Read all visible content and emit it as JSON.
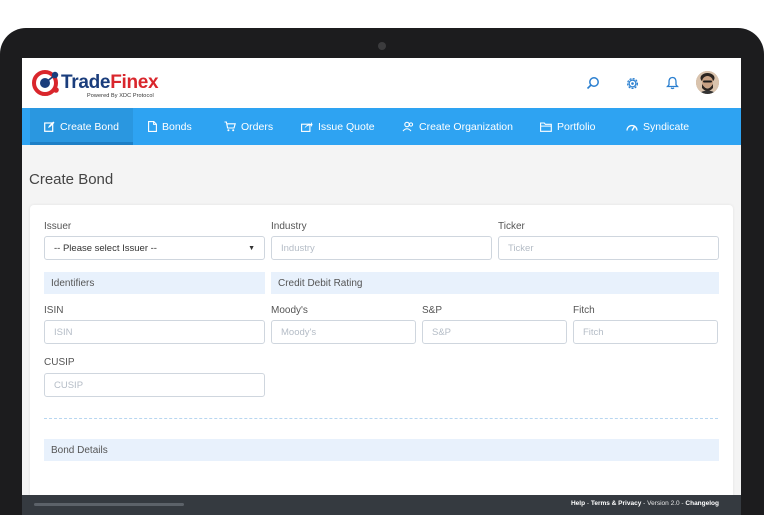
{
  "app": {
    "brand_part1": "Trade",
    "brand_part2": "Finex",
    "tagline": "Powered By XDC Protocol"
  },
  "header_icons": [
    "search-icon",
    "gear-icon",
    "bell-icon",
    "avatar"
  ],
  "nav": {
    "items": [
      {
        "label": "Create Bond",
        "icon": "edit-icon",
        "active": true
      },
      {
        "label": "Bonds",
        "icon": "document-icon"
      },
      {
        "label": "Orders",
        "icon": "cart-icon"
      },
      {
        "label": "Issue Quote",
        "icon": "share-icon"
      },
      {
        "label": "Create Organization",
        "icon": "users-icon"
      },
      {
        "label": "Portfolio",
        "icon": "folder-icon"
      },
      {
        "label": "Syndicate",
        "icon": "dashboard-icon"
      }
    ]
  },
  "page": {
    "title": "Create Bond"
  },
  "form": {
    "issuer": {
      "label": "Issuer",
      "value": "-- Please select Issuer --"
    },
    "industry": {
      "label": "Industry",
      "placeholder": "Industry"
    },
    "ticker": {
      "label": "Ticker",
      "placeholder": "Ticker"
    },
    "sections": {
      "identifiers": "Identifiers",
      "credit_debit_rating": "Credit Debit Rating",
      "bond_details": "Bond Details"
    },
    "isin": {
      "label": "ISIN",
      "placeholder": "ISIN"
    },
    "moodys": {
      "label": "Moody's",
      "placeholder": "Moody's"
    },
    "sp": {
      "label": "S&P",
      "placeholder": "S&P"
    },
    "fitch": {
      "label": "Fitch",
      "placeholder": "Fitch"
    },
    "cusip": {
      "label": "CUSIP",
      "placeholder": "CUSIP"
    }
  },
  "footer": {
    "help": "Help",
    "sep": " - ",
    "terms": "Terms & Privacy",
    "version": "Version 2.0",
    "changelog": "Changelog"
  },
  "colors": {
    "nav_bg": "#2ea3f2",
    "brand_blue": "#1a3d7c",
    "brand_red": "#d9262c",
    "section_band": "#e8f1fc",
    "footer_bg": "#353a40"
  }
}
